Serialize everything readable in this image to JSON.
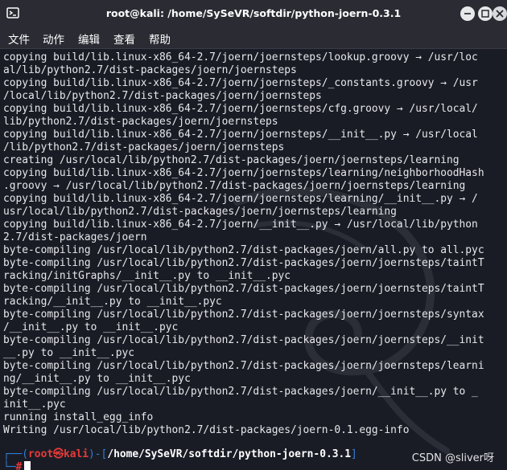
{
  "window": {
    "title": "root@kali: /home/SySeVR/softdir/python-joern-0.3.1"
  },
  "menu": [
    "文件",
    "动作",
    "编辑",
    "查看",
    "帮助"
  ],
  "terminal": {
    "lines": [
      "copying build/lib.linux-x86_64-2.7/joern/joernsteps/lookup.groovy → /usr/loc",
      "al/lib/python2.7/dist-packages/joern/joernsteps",
      "copying build/lib.linux-x86_64-2.7/joern/joernsteps/_constants.groovy → /usr",
      "/local/lib/python2.7/dist-packages/joern/joernsteps",
      "copying build/lib.linux-x86_64-2.7/joern/joernsteps/cfg.groovy → /usr/local/",
      "lib/python2.7/dist-packages/joern/joernsteps",
      "copying build/lib.linux-x86_64-2.7/joern/joernsteps/__init__.py → /usr/local",
      "/lib/python2.7/dist-packages/joern/joernsteps",
      "creating /usr/local/lib/python2.7/dist-packages/joern/joernsteps/learning",
      "copying build/lib.linux-x86_64-2.7/joern/joernsteps/learning/neighborhoodHash",
      ".groovy → /usr/local/lib/python2.7/dist-packages/joern/joernsteps/learning",
      "copying build/lib.linux-x86_64-2.7/joern/joernsteps/learning/__init__.py → /",
      "usr/local/lib/python2.7/dist-packages/joern/joernsteps/learning",
      "copying build/lib.linux-x86_64-2.7/joern/__init__.py → /usr/local/lib/python",
      "2.7/dist-packages/joern",
      "byte-compiling /usr/local/lib/python2.7/dist-packages/joern/all.py to all.pyc",
      "byte-compiling /usr/local/lib/python2.7/dist-packages/joern/joernsteps/taintT",
      "racking/initGraphs/__init__.py to __init__.pyc",
      "byte-compiling /usr/local/lib/python2.7/dist-packages/joern/joernsteps/taintT",
      "racking/__init__.py to __init__.pyc",
      "byte-compiling /usr/local/lib/python2.7/dist-packages/joern/joernsteps/syntax",
      "/__init__.py to __init__.pyc",
      "byte-compiling /usr/local/lib/python2.7/dist-packages/joern/joernsteps/__init",
      "__.py to __init__.pyc",
      "byte-compiling /usr/local/lib/python2.7/dist-packages/joern/joernsteps/learni",
      "ng/__init__.py to __init__.pyc",
      "byte-compiling /usr/local/lib/python2.7/dist-packages/joern/__init__.py to _",
      "init__.pyc",
      "running install_egg_info",
      "Writing /usr/local/lib/python2.7/dist-packages/joern-0.1.egg-info"
    ],
    "prompt": {
      "open": "┌──(",
      "user": "root㉿kali",
      "mid": ")-[",
      "path": "/home/SySeVR/softdir/python-joern-0.3.1",
      "close": "]",
      "line2": "└─",
      "hash": "#"
    }
  },
  "watermark_text": "CSDN @sliver呀",
  "colors": {
    "background": "#1a1c25",
    "text": "#e7e8ec",
    "prompt_user": "#e83a3a",
    "prompt_bracket": "#2f7dd7"
  }
}
